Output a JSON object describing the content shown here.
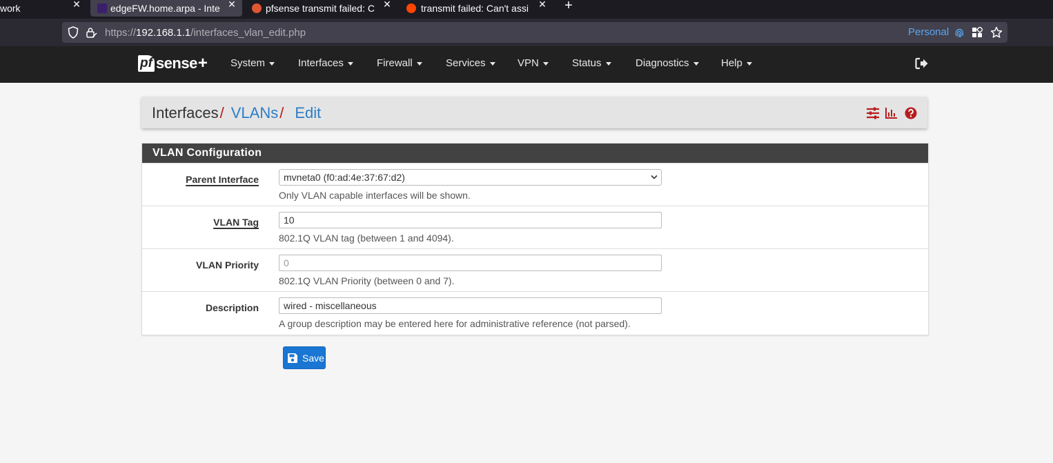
{
  "browser": {
    "tabs": [
      {
        "title": "work",
        "active": false
      },
      {
        "title": "edgeFW.home.arpa - Inte",
        "active": true
      },
      {
        "title": "pfsense transmit failed: C",
        "active": false
      },
      {
        "title": "transmit failed: Can't assi",
        "active": false
      }
    ],
    "new_tab": "+",
    "url_prefix": "https://",
    "url_host": "192.168.1.1",
    "url_path": "/interfaces_vlan_edit.php",
    "container_label": "Personal"
  },
  "pfsense": {
    "logo": {
      "pf": "pf",
      "sense": "sense",
      "plus": "+"
    },
    "menu": [
      "System",
      "Interfaces",
      "Firewall",
      "Services",
      "VPN",
      "Status",
      "Diagnostics",
      "Help"
    ]
  },
  "breadcrumb": {
    "items": [
      "Interfaces",
      "VLANs",
      "Edit"
    ],
    "separator": "/"
  },
  "panel": {
    "title": "VLAN Configuration",
    "rows": [
      {
        "label": "Parent Interface",
        "value": "mvneta0 (f0:ad:4e:37:67:d2)",
        "help": "Only VLAN capable interfaces will be shown."
      },
      {
        "label": "VLAN Tag",
        "value": "10",
        "help": "802.1Q VLAN tag (between 1 and 4094)."
      },
      {
        "label": "VLAN Priority",
        "placeholder": "0",
        "help": "802.1Q VLAN Priority (between 0 and 7)."
      },
      {
        "label": "Description",
        "value": "wired - miscellaneous",
        "help": "A group description may be entered here for administrative reference (not parsed)."
      }
    ]
  },
  "save_label": "Save",
  "colors": {
    "accent_red": "#b71c1c",
    "link_blue": "#2d7dc6",
    "button_blue": "#1976d2",
    "nav_dark": "#212121",
    "panel_heading": "#424242"
  },
  "icons": [
    "shield-icon",
    "lock-icon",
    "fingerprint-icon",
    "extensions-icon",
    "star-icon",
    "logout-icon",
    "sliders-icon",
    "chart-icon",
    "help-icon",
    "floppy-icon",
    "chevron-down-icon",
    "close-icon"
  ]
}
